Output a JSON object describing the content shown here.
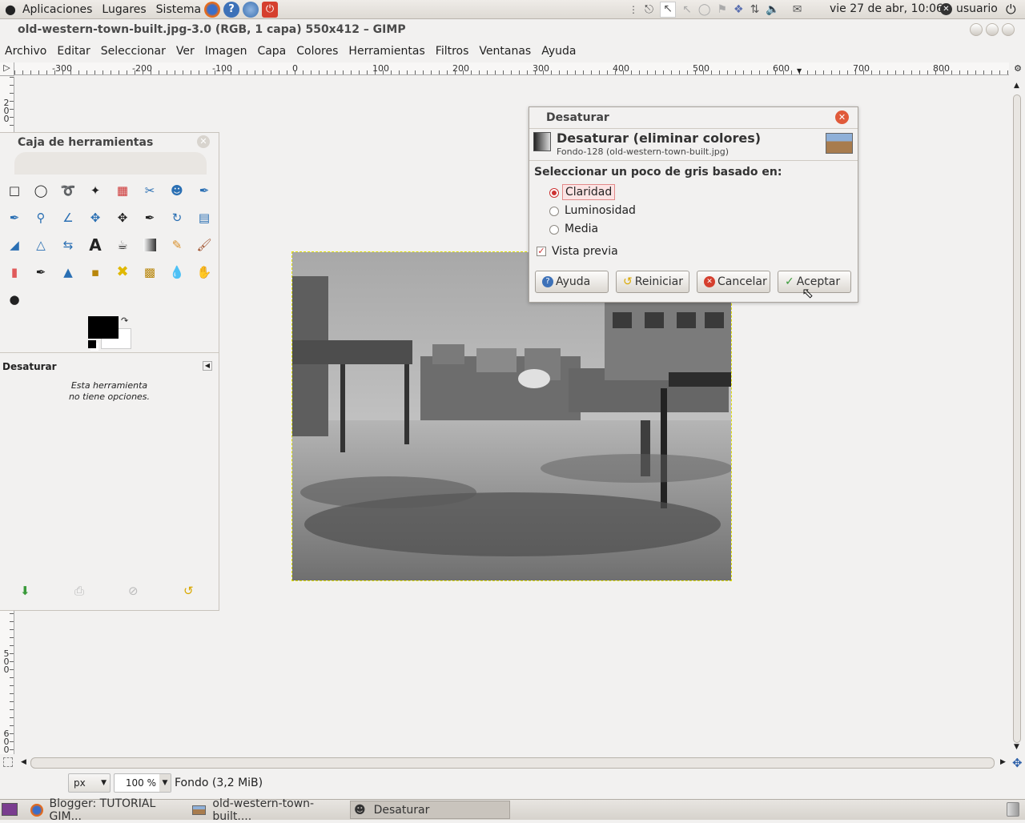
{
  "top_panel": {
    "menus": [
      "Aplicaciones",
      "Lugares",
      "Sistema"
    ],
    "datetime": "vie 27 de abr, 10:06",
    "user": "usuario"
  },
  "window": {
    "title": "old-western-town-built.jpg-3.0 (RGB, 1 capa) 550x412 – GIMP",
    "menubar": [
      "Archivo",
      "Editar",
      "Seleccionar",
      "Ver",
      "Imagen",
      "Capa",
      "Colores",
      "Herramientas",
      "Filtros",
      "Ventanas",
      "Ayuda"
    ]
  },
  "ruler": {
    "h_labels": [
      "-300",
      "-200",
      "-100",
      "0",
      "100",
      "200",
      "300",
      "400",
      "500",
      "600",
      "700",
      "800"
    ],
    "v_labels": [
      "2 0 0",
      "5 0 0",
      "6 0 0"
    ]
  },
  "toolbox": {
    "title": "Caja de herramientas",
    "options_title": "Desaturar",
    "options_text_1": "Esta herramienta",
    "options_text_2": "no tiene opciones.",
    "fg_color": "#000000",
    "bg_color": "#ffffff"
  },
  "dialog": {
    "window_title": "Desaturar",
    "heading": "Desaturar (eliminar colores)",
    "subheading": "Fondo-128 (old-western-town-built.jpg)",
    "prompt": "Seleccionar un poco de gris basado en:",
    "options": [
      "Claridad",
      "Luminosidad",
      "Media"
    ],
    "selected_option": "Claridad",
    "preview_label": "Vista previa",
    "preview_checked": true,
    "buttons": {
      "help": "Ayuda",
      "reset": "Reiniciar",
      "cancel": "Cancelar",
      "ok": "Aceptar"
    }
  },
  "statusbar": {
    "unit": "px",
    "zoom": "100 %",
    "layer_info": "Fondo (3,2 MiB)"
  },
  "taskbar": {
    "tasks": [
      "Blogger: TUTORIAL GIM...",
      "old-western-town-built....",
      "Desaturar"
    ]
  }
}
